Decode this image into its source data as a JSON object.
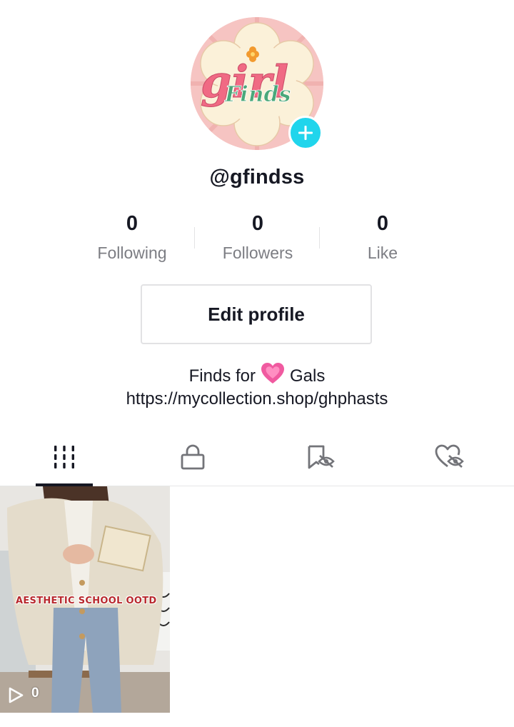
{
  "profile": {
    "username": "@gfindss",
    "avatar_text_main": "girl",
    "avatar_text_sub": "Finds"
  },
  "stats": [
    {
      "value": "0",
      "label": "Following"
    },
    {
      "value": "0",
      "label": "Followers"
    },
    {
      "value": "0",
      "label": "Like"
    }
  ],
  "actions": {
    "edit_profile": "Edit profile"
  },
  "bio": {
    "before": "Finds for",
    "emoji": "pink-heart",
    "after": "Gals",
    "link": "https://mycollection.shop/ghphasts"
  },
  "tabs": [
    {
      "icon": "grid-icon",
      "selected": true
    },
    {
      "icon": "lock-icon",
      "selected": false
    },
    {
      "icon": "bookmark-hidden-icon",
      "selected": false
    },
    {
      "icon": "heart-hidden-icon",
      "selected": false
    }
  ],
  "videos": [
    {
      "overlay_text": "AESTHETIC SCHOOL OOTD",
      "views": "0"
    }
  ],
  "colors": {
    "accent": "#20d5ec",
    "text": "#161823",
    "muted": "#7c7d83"
  }
}
